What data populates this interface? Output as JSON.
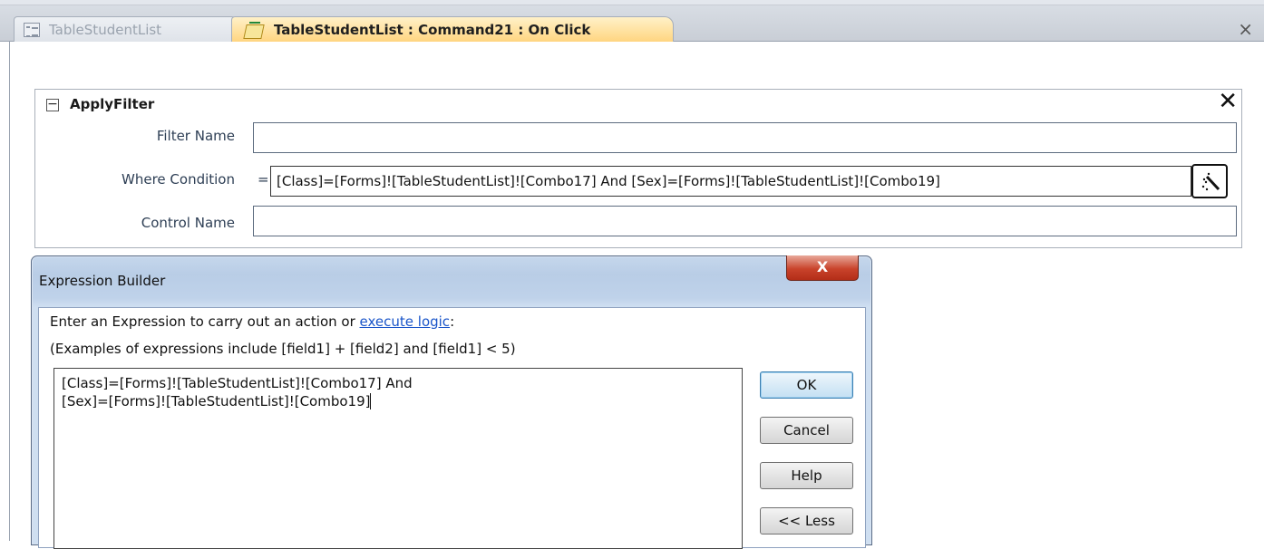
{
  "tabs": [
    {
      "label": "TableStudentList",
      "active": false
    },
    {
      "label": "TableStudentList : Command21 : On Click",
      "active": true
    }
  ],
  "tabbar": {
    "close_glyph": "×"
  },
  "macro": {
    "action": "ApplyFilter",
    "collapse_glyph": "⊟",
    "delete_glyph": "X",
    "filter_name_label": "Filter Name",
    "filter_name_value": "",
    "where_label": "Where Condition",
    "where_eq": "=",
    "where_value": "[Class]=[Forms]![TableStudentList]![Combo17] And [Sex]=[Forms]![TableStudentList]![Combo19]",
    "control_name_label": "Control Name",
    "control_name_value": ""
  },
  "dialog": {
    "title": "Expression Builder",
    "close_glyph": "X",
    "instruction_pre": "Enter an Expression to carry out an action or ",
    "instruction_link": "execute logic",
    "instruction_post": ":",
    "examples": "(Examples of expressions include [field1] + [field2] and [field1] < 5)",
    "expression_line1": "[Class]=[Forms]![TableStudentList]![Combo17] And",
    "expression_line2": "[Sex]=[Forms]![TableStudentList]![Combo19]",
    "buttons": {
      "ok": "OK",
      "cancel": "Cancel",
      "help": "Help",
      "less": "<< Less"
    }
  },
  "icons": [
    "form-tab-icon",
    "macro-tab-icon",
    "collapse-icon",
    "delete-action-icon",
    "expression-builder-wand-icon",
    "close-icon"
  ]
}
